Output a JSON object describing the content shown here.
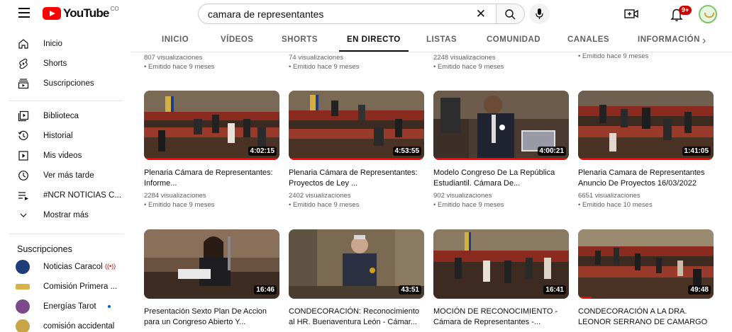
{
  "header": {
    "logo_text": "YouTube",
    "country_code": "CO",
    "search_value": "camara de representantes",
    "notification_count": "9+"
  },
  "sidebar": {
    "items": [
      {
        "label": "Inicio",
        "icon": "home-icon"
      },
      {
        "label": "Shorts",
        "icon": "shorts-icon"
      },
      {
        "label": "Suscripciones",
        "icon": "subscriptions-icon"
      },
      {
        "label": "Biblioteca",
        "icon": "library-icon"
      },
      {
        "label": "Historial",
        "icon": "history-icon"
      },
      {
        "label": "Mis videos",
        "icon": "my-videos-icon"
      },
      {
        "label": "Ver más tarde",
        "icon": "watch-later-icon"
      },
      {
        "label": "#NCR NOTICIAS C...",
        "icon": "playlist-icon"
      },
      {
        "label": "Mostrar más",
        "icon": "chevron-down-icon"
      }
    ],
    "subscriptions_heading": "Suscripciones",
    "subscriptions": [
      {
        "label": "Noticias Caracol",
        "status": "live",
        "color": "#1e3c78"
      },
      {
        "label": "Comisión Primera ...",
        "status": "",
        "color": "#d8b14a"
      },
      {
        "label": "Energías Tarot",
        "status": "new",
        "color": "#7a4a8a"
      },
      {
        "label": "comisión accidental",
        "status": "",
        "color": "#c9a54a"
      }
    ]
  },
  "tabs": [
    {
      "label": "INICIO"
    },
    {
      "label": "VÍDEOS"
    },
    {
      "label": "SHORTS"
    },
    {
      "label": "EN DIRECTO"
    },
    {
      "label": "LISTAS"
    },
    {
      "label": "COMUNIDAD"
    },
    {
      "label": "CANALES"
    },
    {
      "label": "INFORMACIÓN"
    }
  ],
  "top_partial_row": [
    {
      "views": "807 visualizaciones",
      "age": "• Emitido hace 9 meses"
    },
    {
      "views": "74 visualizaciones",
      "age": "• Emitido hace 9 meses"
    },
    {
      "views": "2248 visualizaciones",
      "age": "• Emitido hace 9 meses"
    },
    {
      "views": "",
      "age": "• Emitido hace 9 meses"
    }
  ],
  "videos": [
    {
      "title": "Plenaria Cámara de Representantes: Informe...",
      "views": "2284 visualizaciones",
      "age": "• Emitido hace 9 meses",
      "duration": "4:02:15"
    },
    {
      "title": "Plenaria Cámara de Representantes: Proyectos de Ley ...",
      "views": "2402 visualizaciones",
      "age": "• Emitido hace 9 meses",
      "duration": "4:53:55"
    },
    {
      "title": "Modelo Congreso De La República Estudiantil. Cámara De...",
      "views": "902 visualizaciones",
      "age": "• Emitido hace 9 meses",
      "duration": "4:00:21"
    },
    {
      "title": "Plenaria Camara de Representantes Anuncio De Proyectos 16/03/2022",
      "views": "6651 visualizaciones",
      "age": "• Emitido hace 10 meses",
      "duration": "1:41:05"
    },
    {
      "title": "Presentación Sexto Plan De Accion para un Congreso Abierto Y...",
      "views": "",
      "age": "",
      "duration": "16:46"
    },
    {
      "title": "CONDECORACIÓN: Reconocimiento al HR. Buenaventura León - Cámar...",
      "views": "",
      "age": "",
      "duration": "43:51"
    },
    {
      "title": "MOCIÓN DE RECONOCIMIENTO - Cámara de Representantes -...",
      "views": "",
      "age": "",
      "duration": "16:41"
    },
    {
      "title": "CONDECORACIÓN A LA DRA. LEONOR SERRANO DE CAMARGO",
      "views": "",
      "age": "",
      "duration": "49:48"
    }
  ],
  "colors": {
    "brand_red": "#ff0000",
    "badge_red": "#cc0000",
    "text_secondary": "#606060"
  }
}
